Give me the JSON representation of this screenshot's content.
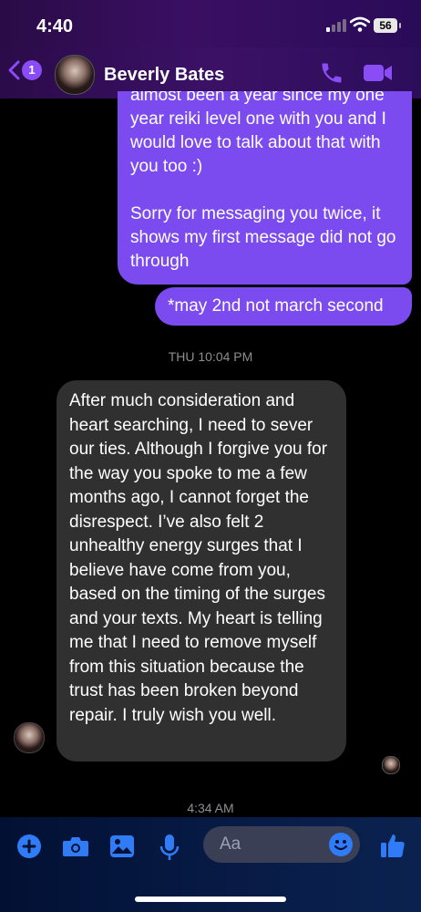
{
  "status": {
    "time": "4:40",
    "battery": "56"
  },
  "header": {
    "unread_count": "1",
    "contact_name": "Beverly Bates"
  },
  "messages": {
    "outgoing_main": "almost been a year since my one year reiki level one with you and I would love to talk about that with you too :)",
    "outgoing_main_2": "Sorry for messaging you twice, it shows my first message did not go through",
    "outgoing_small": "*may 2nd not march second",
    "timestamp_1": "THU 10:04 PM",
    "incoming": "After much consideration and heart searching, I need to sever our ties. Although I forgive you for the way you spoke to me a few months ago, I cannot forget the disrespect. I’ve also felt 2 unhealthy energy surges that I believe have come from you, based on the timing of the surges and your texts. My heart is telling me that I need to remove myself from this situation because the trust has been broken beyond repair. I truly wish you well.",
    "timestamp_2": "4:34 AM"
  },
  "composer": {
    "placeholder": "Aa"
  },
  "colors": {
    "accent": "#7b4bf0",
    "icon_purple": "#8a4cf4",
    "icon_blue": "#2f7cf6"
  }
}
